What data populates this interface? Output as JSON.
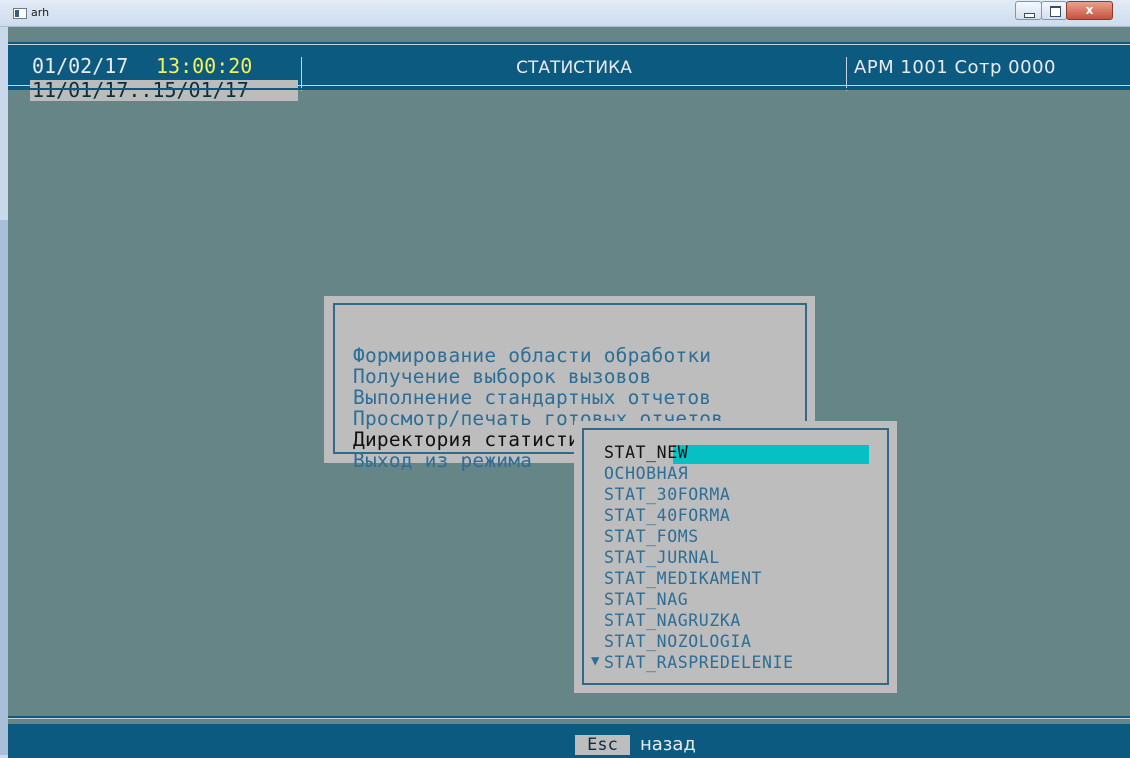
{
  "window": {
    "title": "arh",
    "close_symbol": "x"
  },
  "header": {
    "date": "01/02/17",
    "time": "13:00:20",
    "title": "СТАТИСТИКА",
    "arm": "АРМ 1001 Сотр 0000",
    "range": "11/01/17..15/01/17"
  },
  "menu": {
    "items": [
      "Формирование области обработки",
      "Получение выборок вызовов",
      "Выполнение стандартных отчетов",
      "Просмотр/печать готовых отчетов",
      "Директория статистики",
      "Выход из режима"
    ],
    "active_index": 4
  },
  "directory": {
    "items": [
      "STAT_NEW",
      "ОСНОВНАЯ",
      "STAT_30FORMA",
      "STAT_40FORMA",
      "STAT_FOMS",
      "STAT_JURNAL",
      "STAT_MEDIKAMENT",
      "STAT_NAG",
      "STAT_NAGRUZKA",
      "STAT_NOZOLOGIA",
      "STAT_RASPREDELENIE"
    ],
    "selected_index": 0,
    "more_indicator": "▼"
  },
  "footer": {
    "key": "Esc",
    "label": "назад"
  },
  "colors": {
    "background": "#668587",
    "bar": "#0d5a80",
    "panel": "#bdbdbd",
    "menu_text": "#2d6e96",
    "highlight": "#06c0c4",
    "time": "#f2f25a"
  }
}
